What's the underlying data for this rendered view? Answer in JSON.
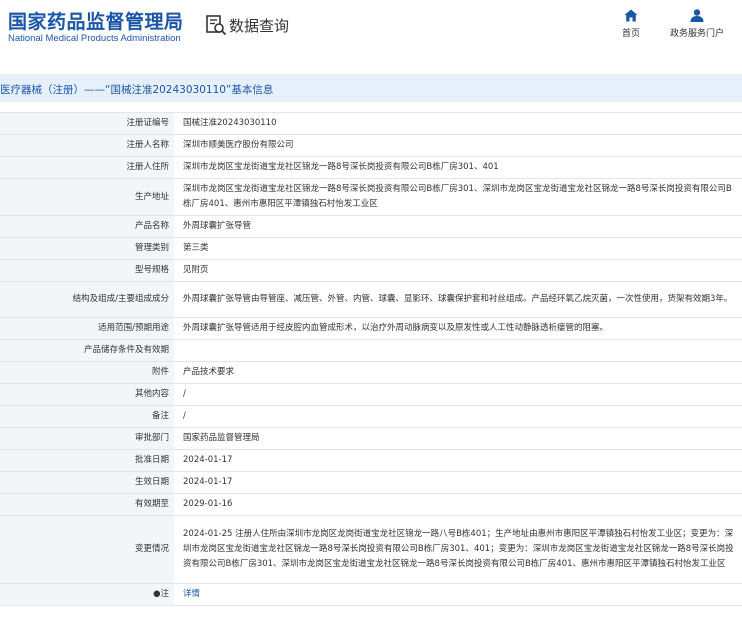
{
  "header": {
    "logo_cn": "国家药品监督管理局",
    "logo_en": "National Medical Products Administration",
    "query_label": "数据查询",
    "nav": [
      {
        "label": "首页",
        "icon": "home-icon"
      },
      {
        "label": "政务服务门户",
        "icon": "user-icon"
      }
    ]
  },
  "title": "医疗器械（注册）——“国械注准20243030110”基本信息",
  "rows": [
    {
      "label": "注册证编号",
      "value": "国械注准20243030110"
    },
    {
      "label": "注册人名称",
      "value": "深圳市顺美医疗股份有限公司"
    },
    {
      "label": "注册人住所",
      "value": "深圳市龙岗区宝龙街道宝龙社区锦龙一路8号深长岗投资有限公司B栋厂房301、401"
    },
    {
      "label": "生产地址",
      "value": "深圳市龙岗区宝龙街道宝龙社区锦龙一路8号深长岗投资有限公司B栋厂房301、深圳市龙岗区宝龙街道宝龙社区锦龙一路8号深长岗投资有限公司B栋厂房401、惠州市惠阳区平潭镇独石村怡发工业区"
    },
    {
      "label": "产品名称",
      "value": "外周球囊扩张导管"
    },
    {
      "label": "管理类别",
      "value": "第三类"
    },
    {
      "label": "型号规格",
      "value": "见附页"
    },
    {
      "label": "结构及组成/主要组成成分",
      "value": "外周球囊扩张导管由导管座、减压管、外管、内管、球囊、显影环、球囊保护套和衬丝组成。产品经环氧乙烷灭菌，一次性使用，货架有效期3年。"
    },
    {
      "label": "适用范围/预期用途",
      "value": "外周球囊扩张导管适用于经皮腔内血管成形术，以治疗外周动脉病变以及原发性或人工性动静脉透析瘘管的阻塞。"
    },
    {
      "label": "产品储存条件及有效期",
      "value": ""
    },
    {
      "label": "附件",
      "value": "产品技术要求"
    },
    {
      "label": "其他内容",
      "value": "/"
    },
    {
      "label": "备注",
      "value": "/"
    },
    {
      "label": "审批部门",
      "value": "国家药品监督管理局"
    },
    {
      "label": "批准日期",
      "value": "2024-01-17"
    },
    {
      "label": "生效日期",
      "value": "2024-01-17"
    },
    {
      "label": "有效期至",
      "value": "2029-01-16"
    },
    {
      "label": "变更情况",
      "value": "2024-01-25 注册人住所由深圳市龙岗区龙岗街道宝龙社区锦龙一路八号B栋401；生产地址由惠州市惠阳区平潭镇独石村怡发工业区；变更为：深圳市龙岗区宝龙街道宝龙社区锦龙一路8号深长岗投资有限公司B栋厂房301、401；变更为：深圳市龙岗区宝龙街道宝龙社区锦龙一路8号深长岗投资有限公司B栋厂房301、深圳市龙岗区宝龙街道宝龙社区锦龙一路8号深长岗投资有限公司B栋厂房401、惠州市惠阳区平潭镇独石村怡发工业区"
    },
    {
      "label": "●注",
      "value": "详情",
      "link": true
    }
  ],
  "colors": {
    "brand": "#1a56a8",
    "title_bg": "#e6f0fa",
    "label_bg": "#f3f5f8",
    "border": "#dfe6ee"
  }
}
